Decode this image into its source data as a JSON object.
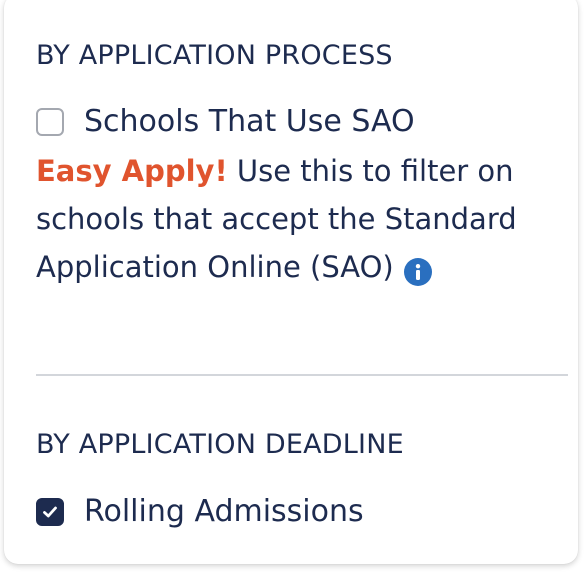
{
  "sections": [
    {
      "heading": "BY APPLICATION PROCESS",
      "option": {
        "label": "Schools That Use SAO",
        "checked": false
      },
      "description": {
        "highlight": "Easy Apply!",
        "text": " Use this to filter on schools that accept the Standard Application Online (SAO)"
      }
    },
    {
      "heading": "BY APPLICATION DEADLINE",
      "option": {
        "label": "Rolling Admissions",
        "checked": true
      }
    }
  ],
  "icons": {
    "info": "info-icon",
    "check": "check-icon"
  },
  "colors": {
    "text": "#1d2b4f",
    "accent": "#e0542e",
    "info": "#2a6fbf",
    "checked_fill": "#1d2b4f",
    "divider": "#d3d6db"
  }
}
